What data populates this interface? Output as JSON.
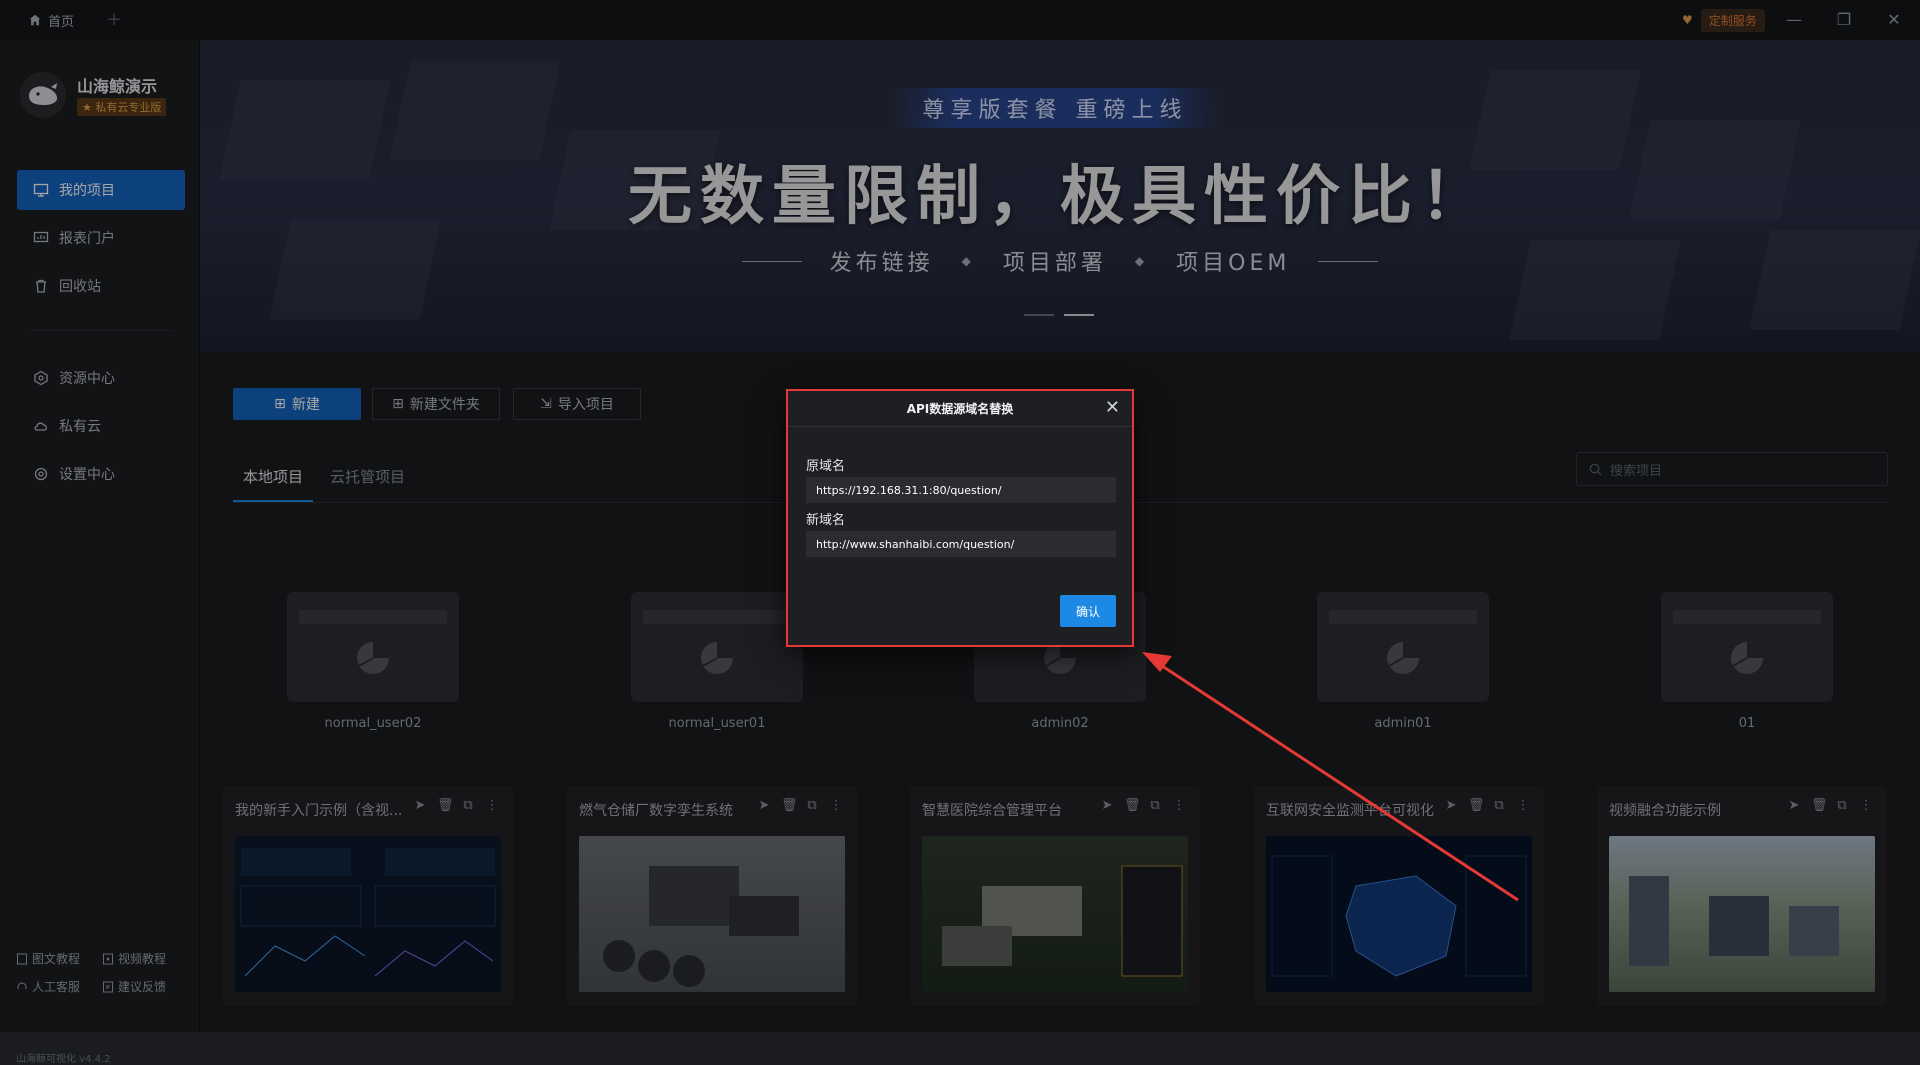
{
  "titlebar": {
    "home_tab": "首页",
    "add_tab": "+",
    "custom_service": "定制服务",
    "minimize": "—",
    "restore": "❐",
    "close": "✕"
  },
  "user": {
    "name": "山海鲸演示",
    "plan": "★ 私有云专业版"
  },
  "nav": {
    "my_projects": "我的项目",
    "report_portal": "报表门户",
    "recycle_bin": "回收站",
    "resource_center": "资源中心",
    "private_cloud": "私有云",
    "settings_center": "设置中心"
  },
  "footer": {
    "text_tutorial": "图文教程",
    "video_tutorial": "视频教程",
    "customer_service": "人工客服",
    "feedback": "建议反馈",
    "version": "山海鲸可视化 v4.4.2"
  },
  "banner": {
    "pill": "尊享版套餐 重磅上线",
    "title": "无数量限制，极具性价比！",
    "features": [
      "发布链接",
      "项目部署",
      "项目OEM"
    ]
  },
  "toolbar": {
    "new": "新建",
    "new_folder": "新建文件夹",
    "import": "导入项目"
  },
  "tabs": {
    "local": "本地项目",
    "cloud": "云托管项目"
  },
  "search": {
    "placeholder": "搜索项目"
  },
  "folders": [
    "normal_user02",
    "normal_user01",
    "admin02",
    "admin01",
    "01"
  ],
  "projects": [
    {
      "title": "我的新手入门示例（含视..."
    },
    {
      "title": "燃气仓储厂数字孪生系统"
    },
    {
      "title": "智慧医院综合管理平台"
    },
    {
      "title": "互联网安全监测平台可视化"
    },
    {
      "title": "视频融合功能示例"
    }
  ],
  "modal": {
    "title": "API数据源域名替换",
    "close": "✕",
    "old_label": "原域名",
    "old_value": "https://192.168.31.1:80/question/",
    "new_label": "新域名",
    "new_value": "http://www.shanhaibi.com/question/",
    "confirm": "确认"
  },
  "colors": {
    "accent": "#1565c0",
    "highlight": "#e53935",
    "confirm": "#1e88e5"
  }
}
